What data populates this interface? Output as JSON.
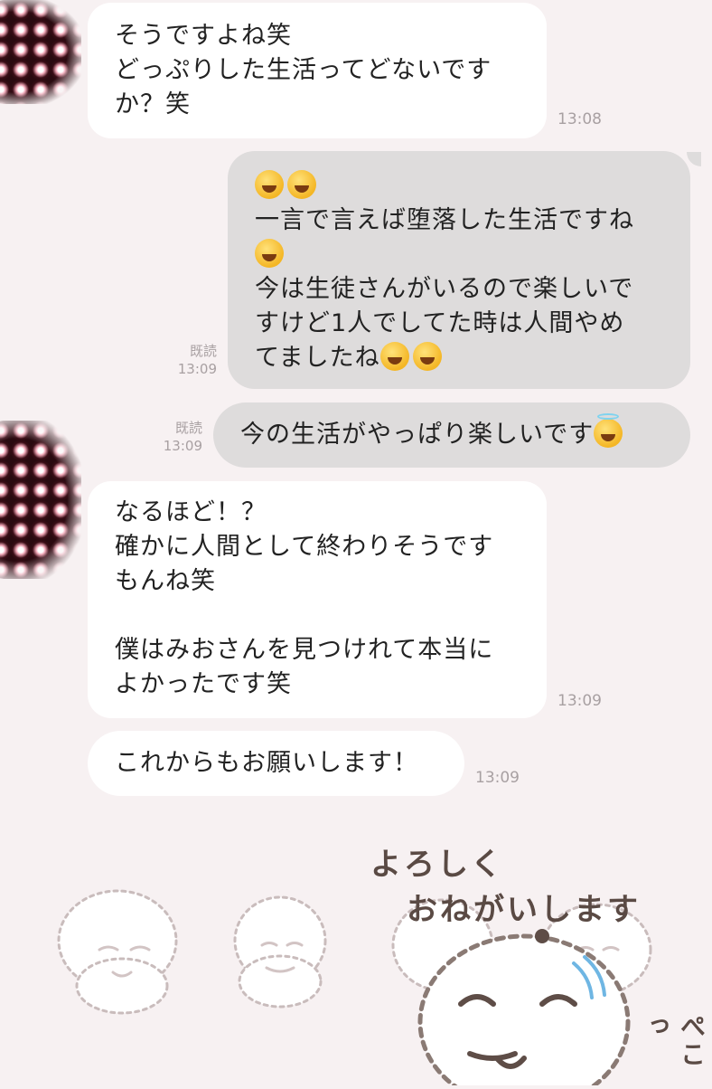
{
  "messages": [
    {
      "from": "other",
      "lines": [
        "そうですよね笑",
        "どっぷりした生活ってどないです",
        "か？笑"
      ],
      "time": "13:08"
    },
    {
      "from": "me",
      "lines": [
        "一言で言えば堕落した生活ですね",
        "今は生徒さんがいるので楽しいで",
        "すけど1人でしてた時は人間やめ",
        "てましたね"
      ],
      "read": "既読",
      "time": "13:09",
      "emojis": [
        "joy-emoji",
        "joy-emoji",
        "joy-emoji",
        "joy-emoji",
        "sob-emoji"
      ]
    },
    {
      "from": "me",
      "lines": [
        "今の生活がやっぱり楽しいです"
      ],
      "read": "既読",
      "time": "13:09",
      "emojis": [
        "halo-smile-emoji"
      ]
    },
    {
      "from": "other",
      "lines": [
        "なるほど！？",
        "確かに人間として終わりそうです",
        "もんね笑",
        "",
        "僕はみおさんを見つけれて本当に",
        "よかったです笑"
      ],
      "time": "13:09"
    },
    {
      "from": "other",
      "lines": [
        "これからもお願いします！"
      ],
      "time": "13:09"
    }
  ],
  "sticker": {
    "line1": "よろしく",
    "line2": "おねがいします",
    "side": "ぺこっ"
  },
  "colors": {
    "background": "#f7f1f2",
    "incoming_bubble": "#ffffff",
    "outgoing_bubble": "#dedcdc",
    "meta_text": "#a8a0a2"
  }
}
